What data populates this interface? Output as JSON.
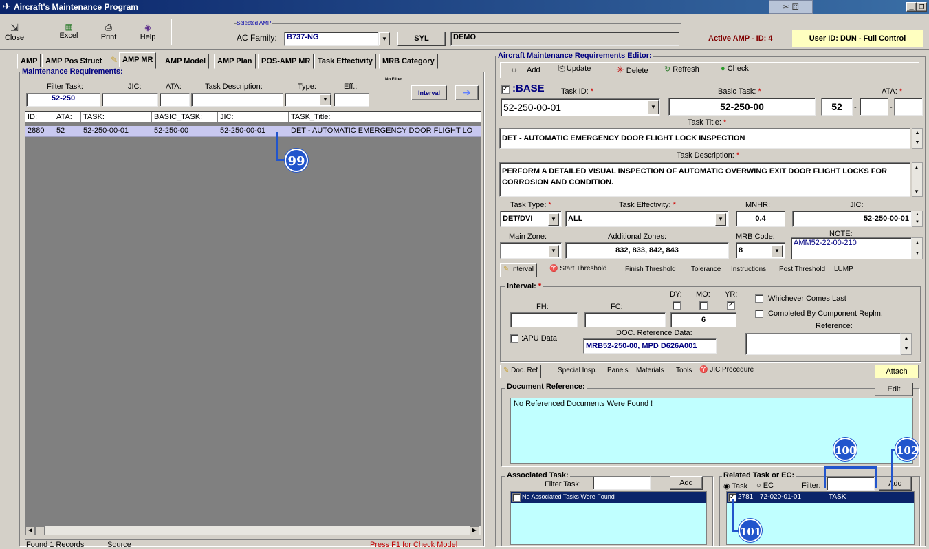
{
  "window": {
    "title": "Aircraft's Maintenance Program"
  },
  "toolbar": {
    "close": "Close",
    "excel": "Excel",
    "print": "Print",
    "help": "Help"
  },
  "amp": {
    "group_label": "Selected AMP:",
    "family_label": "AC Family:",
    "family_value": "B737-NG",
    "code": "SYL",
    "name": "DEMO",
    "active": "Active AMP - ID: 4",
    "user": "User ID: DUN - Full Control"
  },
  "tabs": [
    "AMP",
    "AMP Pos Struct",
    "AMP MR",
    "AMP Model",
    "AMP Plan",
    "POS-AMP MR",
    "Task Effectivity",
    "MRB Category"
  ],
  "left": {
    "group_title": "Maintenance Requirements:",
    "filter_task_label": "Filter Task:",
    "filter_task_value": "52-250",
    "jic_label": "JIC:",
    "ata_label": "ATA:",
    "desc_label": "Task Description:",
    "type_label": "Type:",
    "eff_label": "Eff.:",
    "no_filter": "No Filter",
    "interval_btn": "Interval",
    "columns": [
      "ID:",
      "ATA:",
      "TASK:",
      "BASIC_TASK:",
      "JIC:",
      "TASK_Title:"
    ],
    "rows": [
      [
        "2880",
        "52",
        "52-250-00-01",
        "52-250-00",
        "52-250-00-01",
        "DET - AUTOMATIC EMERGENCY DOOR FLIGHT LO"
      ]
    ],
    "status_found": "Found 1 Records",
    "status_source": "Source",
    "status_hint": "Press F1 for Check Model"
  },
  "editor": {
    "title": "Aircraft Maintenance Requirements Editor:",
    "add": "Add",
    "update": "Update",
    "delete": "Delete",
    "refresh": "Refresh",
    "check": "Check",
    "base_label": ":BASE",
    "task_id_label": "Task ID:",
    "task_id": "52-250-00-01",
    "basic_task_label": "Basic Task:",
    "basic_task": "52-250-00",
    "ata_label": "ATA:",
    "ata1": "52",
    "ata2": "",
    "ata3": "",
    "task_title_label": "Task Title:",
    "task_title": "DET - AUTOMATIC EMERGENCY DOOR FLIGHT LOCK INSPECTION",
    "task_desc_label": "Task Description:",
    "task_desc": "PERFORM A DETAILED VISUAL INSPECTION OF AUTOMATIC OVERWING EXIT DOOR FLIGHT LOCKS FOR CORROSION AND CONDITION.",
    "task_type_label": "Task Type:",
    "task_type": "DET/DVI",
    "task_eff_label": "Task Effectivity:",
    "task_eff": "ALL",
    "mnhr_label": "MNHR:",
    "mnhr": "0.4",
    "jic_label": "JIC:",
    "jic": "52-250-00-01",
    "main_zone_label": "Main Zone:",
    "main_zone": "",
    "add_zones_label": "Additional Zones:",
    "add_zones": "832, 833, 842, 843",
    "mrb_label": "MRB Code:",
    "mrb": "8",
    "note_label": "NOTE:",
    "note": "AMM52-22-00-210"
  },
  "subtabs": [
    "Interval",
    "Start Threshold",
    "Finish Threshold",
    "Tolerance",
    "Instructions",
    "Post Threshold",
    "LUMP"
  ],
  "interval": {
    "title": "Interval:",
    "fh_label": "FH:",
    "fc_label": "FC:",
    "dy_label": "DY:",
    "mo_label": "MO:",
    "yr_label": "YR:",
    "fh": "",
    "fc": "",
    "yr_value": "6",
    "wcl": ":Whichever Comes Last",
    "ccr": ":Completed By Component Replm.",
    "reference_label": "Reference:",
    "apu": ":APU Data",
    "doc_ref_label": "DOC. Reference Data:",
    "doc_ref": "MRB52-250-00, MPD D626A001"
  },
  "doctabs": [
    "Doc. Ref",
    "Special Insp.",
    "Panels",
    "Materials",
    "Tools",
    "JIC Procedure"
  ],
  "attach": "Attach",
  "docref": {
    "title": "Document Reference:",
    "edit": "Edit",
    "empty": "No Referenced Documents Were Found !"
  },
  "assoc": {
    "title": "Associated Task:",
    "filter_label": "Filter Task:",
    "add": "Add",
    "empty": "No Associated Tasks Were Found !"
  },
  "related": {
    "title": "Related Task or EC:",
    "task_opt": "Task",
    "ec_opt": "EC",
    "filter_label": "Filter:",
    "add": "Add",
    "row_id": "2781",
    "row_task": "72-020-01-01",
    "row_type": "TASK"
  },
  "callouts": {
    "c99": "99",
    "c100": "100",
    "c101": "101",
    "c102": "102"
  }
}
